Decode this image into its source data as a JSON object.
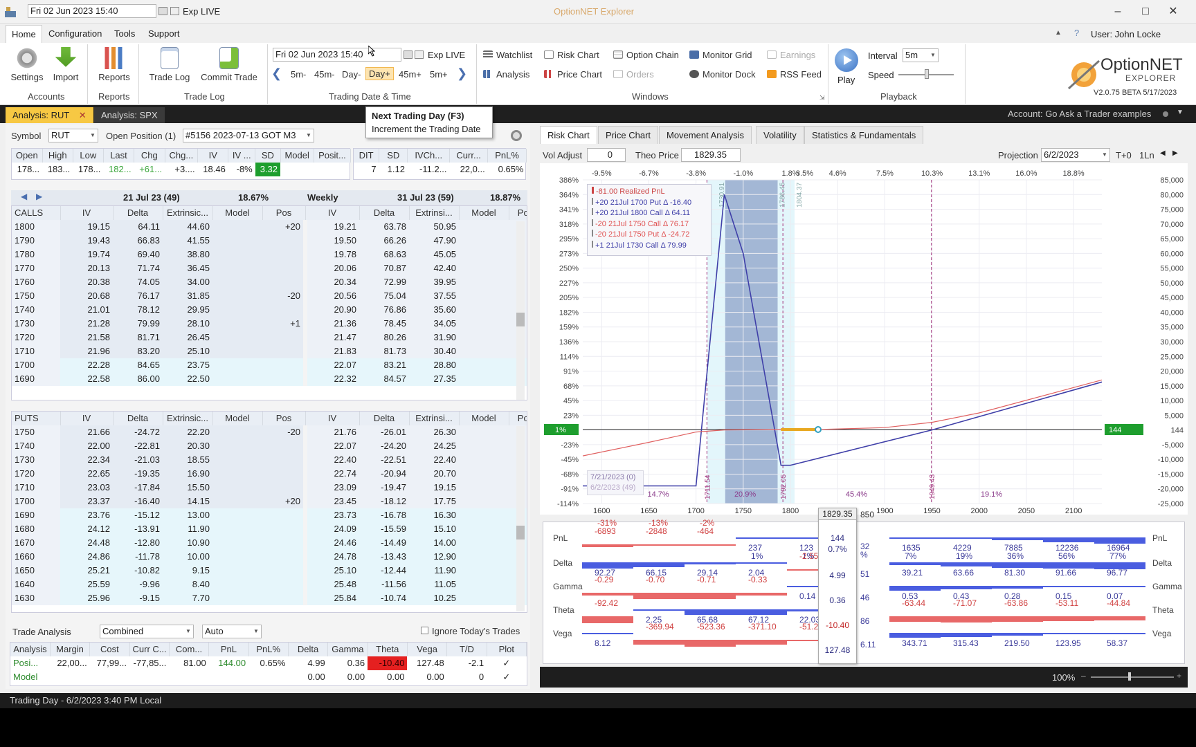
{
  "titlebar": {
    "date": "Fri 02 Jun 2023 15:40",
    "exp": "Exp LIVE",
    "app_title": "OptionNET Explorer"
  },
  "menu": {
    "tabs": [
      "Home",
      "Configuration",
      "Tools",
      "Support"
    ],
    "user": "User: John Locke"
  },
  "ribbon": {
    "settings": "Settings",
    "import": "Import",
    "reports": "Reports",
    "trade_log": "Trade Log",
    "commit_trade": "Commit Trade",
    "groups": {
      "accounts": "Accounts",
      "reports": "Reports",
      "trade_log": "Trade Log",
      "trading_date_time": "Trading Date & Time",
      "windows": "Windows",
      "playback": "Playback"
    },
    "date_field": "Fri 02 Jun 2023 15:40",
    "exp_field": "Exp LIVE",
    "nav_buttons": [
      "5m-",
      "45m-",
      "Day-",
      "Day+",
      "45m+",
      "5m+"
    ],
    "windows_items": {
      "watchlist": "Watchlist",
      "risk_chart": "Risk Chart",
      "option_chain": "Option Chain",
      "monitor_grid": "Monitor Grid",
      "earnings": "Earnings",
      "analysis": "Analysis",
      "price_chart": "Price Chart",
      "orders": "Orders",
      "monitor_dock": "Monitor Dock",
      "rss_feed": "RSS Feed"
    },
    "play": "Play",
    "interval_label": "Interval",
    "interval_value": "5m",
    "speed_label": "Speed",
    "logo_name": "OptionNET",
    "logo_sub": "EXPLORER",
    "version": "V2.0.75 BETA 5/17/2023"
  },
  "doc_tabs": {
    "tab1": "Analysis: RUT",
    "tab2": "Analysis: SPX",
    "account": "Account: Go Ask a Trader examples"
  },
  "tooltip": {
    "title": "Next Trading Day (F3)",
    "desc": "Increment the Trading Date"
  },
  "symbol_bar": {
    "symbol_label": "Symbol",
    "symbol": "RUT",
    "open_position_label": "Open Position (1)",
    "position": "#5156 2023-07-13 GOT M3"
  },
  "quote": {
    "headers": [
      "Open",
      "High",
      "Low",
      "Last",
      "Chg",
      "Chg...",
      "IV",
      "IV ...",
      "SD",
      "Model",
      "Posit..."
    ],
    "values": [
      "178...",
      "183...",
      "178...",
      "182...",
      "+61...",
      "+3....",
      "18.46",
      "-8%",
      "3.32",
      "",
      ""
    ],
    "headers2": [
      "DIT",
      "SD",
      "IVCh...",
      "Curr...",
      "PnL%"
    ],
    "values2": [
      "7",
      "1.12",
      "-11.2...",
      "22,0...",
      "0.65%"
    ]
  },
  "chain": {
    "exp1": "21 Jul 23 (49)",
    "exp1_iv": "18.67%",
    "weekly": "Weekly",
    "exp2": "31 Jul 23 (59)",
    "exp2_iv": "18.87%",
    "col_headers": [
      "IV",
      "Delta",
      "Extrinsic...",
      "Model",
      "Pos"
    ],
    "col_headers2": [
      "IV",
      "Delta",
      "Extrinsi...",
      "Model",
      "Pos"
    ],
    "calls_label": "CALLS",
    "puts_label": "PUTS",
    "calls": [
      [
        "1800",
        "19.15",
        "64.11",
        "44.60",
        "",
        "+20",
        "19.21",
        "63.78",
        "50.95",
        "",
        ""
      ],
      [
        "1790",
        "19.43",
        "66.83",
        "41.55",
        "",
        "",
        "19.50",
        "66.26",
        "47.90",
        "",
        ""
      ],
      [
        "1780",
        "19.74",
        "69.40",
        "38.80",
        "",
        "",
        "19.78",
        "68.63",
        "45.05",
        "",
        ""
      ],
      [
        "1770",
        "20.13",
        "71.74",
        "36.45",
        "",
        "",
        "20.06",
        "70.87",
        "42.40",
        "",
        ""
      ],
      [
        "1760",
        "20.38",
        "74.05",
        "34.00",
        "",
        "",
        "20.34",
        "72.99",
        "39.95",
        "",
        ""
      ],
      [
        "1750",
        "20.68",
        "76.17",
        "31.85",
        "",
        "-20",
        "20.56",
        "75.04",
        "37.55",
        "",
        ""
      ],
      [
        "1740",
        "21.01",
        "78.12",
        "29.95",
        "",
        "",
        "20.90",
        "76.86",
        "35.60",
        "",
        ""
      ],
      [
        "1730",
        "21.28",
        "79.99",
        "28.10",
        "",
        "+1",
        "21.36",
        "78.45",
        "34.05",
        "",
        ""
      ],
      [
        "1720",
        "21.58",
        "81.71",
        "26.45",
        "",
        "",
        "21.47",
        "80.26",
        "31.90",
        "",
        ""
      ],
      [
        "1710",
        "21.96",
        "83.20",
        "25.10",
        "",
        "",
        "21.83",
        "81.73",
        "30.40",
        "",
        ""
      ],
      [
        "1700",
        "22.28",
        "84.65",
        "23.75",
        "",
        "",
        "22.07",
        "83.21",
        "28.80",
        "",
        ""
      ],
      [
        "1690",
        "22.58",
        "86.00",
        "22.50",
        "",
        "",
        "22.32",
        "84.57",
        "27.35",
        "",
        ""
      ]
    ],
    "puts": [
      [
        "1750",
        "21.66",
        "-24.72",
        "22.20",
        "",
        "-20",
        "21.76",
        "-26.01",
        "26.30",
        "",
        ""
      ],
      [
        "1740",
        "22.00",
        "-22.81",
        "20.30",
        "",
        "",
        "22.07",
        "-24.20",
        "24.25",
        "",
        ""
      ],
      [
        "1730",
        "22.34",
        "-21.03",
        "18.55",
        "",
        "",
        "22.40",
        "-22.51",
        "22.40",
        "",
        ""
      ],
      [
        "1720",
        "22.65",
        "-19.35",
        "16.90",
        "",
        "",
        "22.74",
        "-20.94",
        "20.70",
        "",
        ""
      ],
      [
        "1710",
        "23.03",
        "-17.84",
        "15.50",
        "",
        "",
        "23.09",
        "-19.47",
        "19.15",
        "",
        ""
      ],
      [
        "1700",
        "23.37",
        "-16.40",
        "14.15",
        "",
        "+20",
        "23.45",
        "-18.12",
        "17.75",
        "",
        ""
      ],
      [
        "1690",
        "23.76",
        "-15.12",
        "13.00",
        "",
        "",
        "23.73",
        "-16.78",
        "16.30",
        "",
        ""
      ],
      [
        "1680",
        "24.12",
        "-13.91",
        "11.90",
        "",
        "",
        "24.09",
        "-15.59",
        "15.10",
        "",
        ""
      ],
      [
        "1670",
        "24.48",
        "-12.80",
        "10.90",
        "",
        "",
        "24.46",
        "-14.49",
        "14.00",
        "",
        ""
      ],
      [
        "1660",
        "24.86",
        "-11.78",
        "10.00",
        "",
        "",
        "24.78",
        "-13.43",
        "12.90",
        "",
        ""
      ],
      [
        "1650",
        "25.21",
        "-10.82",
        "9.15",
        "",
        "",
        "25.10",
        "-12.44",
        "11.90",
        "",
        ""
      ],
      [
        "1640",
        "25.59",
        "-9.96",
        "8.40",
        "",
        "",
        "25.48",
        "-11.56",
        "11.05",
        "",
        ""
      ],
      [
        "1630",
        "25.96",
        "-9.15",
        "7.70",
        "",
        "",
        "25.84",
        "-10.74",
        "10.25",
        "",
        ""
      ]
    ]
  },
  "trade_analysis": {
    "label": "Trade Analysis",
    "mode": "Combined",
    "auto": "Auto",
    "ignore_today": "Ignore Today's Trades",
    "headers": [
      "Analysis",
      "Margin",
      "Cost",
      "Curr C...",
      "Com...",
      "PnL",
      "PnL%",
      "Delta",
      "Gamma",
      "Theta",
      "Vega",
      "T/D",
      "Plot"
    ],
    "rows": [
      [
        "Posi...",
        "22,00...",
        "77,99...",
        "-77,85...",
        "81.00",
        "144.00",
        "0.65%",
        "4.99",
        "0.36",
        "-10.40",
        "127.48",
        "-2.1",
        "✓"
      ],
      [
        "Model",
        "",
        "",
        "",
        "",
        "",
        "",
        "0.00",
        "0.00",
        "0.00",
        "0.00",
        "0",
        "✓"
      ]
    ]
  },
  "status": "Trading Day - 6/2/2023 3:40 PM Local",
  "right_panel": {
    "tabs": [
      "Risk Chart",
      "Price Chart",
      "Movement Analysis",
      "Volatility",
      "Statistics & Fundamentals"
    ],
    "vol_adjust_label": "Vol Adjust",
    "vol_adjust": "0",
    "theo_price_label": "Theo Price",
    "theo_price": "1829.35",
    "projection_label": "Projection",
    "projection": "6/2/2023",
    "t0": "T+0",
    "oneln": "1Ln",
    "zoom": "100%"
  },
  "chart_data": {
    "type": "line",
    "title": "",
    "x_ticks": [
      1600,
      1650,
      1700,
      1750,
      1800,
      1850,
      1900,
      1950,
      2000,
      2050,
      2100
    ],
    "top_pct_ticks": [
      "-9.5%",
      "-6.7%",
      "-3.8%",
      "-1.0%",
      "1.8%",
      "3.5%",
      "4.6%",
      "7.5%",
      "10.3%",
      "13.1%",
      "16.0%",
      "18.8%"
    ],
    "left_pct_ticks": [
      "386%",
      "364%",
      "341%",
      "318%",
      "295%",
      "273%",
      "250%",
      "227%",
      "205%",
      "182%",
      "159%",
      "136%",
      "114%",
      "91%",
      "68%",
      "45%",
      "23%",
      "1%",
      "-23%",
      "-45%",
      "-68%",
      "-91%",
      "-114%"
    ],
    "right_ticks": [
      "85,000",
      "80,000",
      "75,000",
      "70,000",
      "65,000",
      "60,000",
      "55,000",
      "50,000",
      "45,000",
      "40,000",
      "35,000",
      "30,000",
      "25,000",
      "20,000",
      "15,000",
      "10,000",
      "5,000",
      "144",
      "-5,000",
      "-10,000",
      "-15,000",
      "-20,000",
      "-25,000"
    ],
    "xlim": [
      1580,
      2130
    ],
    "ylim": [
      -25000,
      85000
    ],
    "series": [
      {
        "name": "7/21/2023 (0)",
        "color": "#3f3fa8",
        "x": [
          1580,
          1700,
          1730,
          1750,
          1790,
          1800,
          1950,
          2130
        ],
        "y": [
          -19000,
          -19000,
          80000,
          60000,
          -12000,
          -12000,
          0,
          16300
        ]
      },
      {
        "name": "6/2/2023 (49)",
        "color": "#e06060",
        "x": [
          1580,
          1650,
          1700,
          1730,
          1790,
          1829,
          1900,
          1950,
          2000,
          2130
        ],
        "y": [
          -8800,
          -4200,
          -700,
          0,
          150,
          144,
          800,
          2600,
          5800,
          17000
        ]
      }
    ],
    "vlines": [
      {
        "x": 1711.54,
        "label": "1711.54"
      },
      {
        "x": 1792.05,
        "label": "1792.05"
      },
      {
        "x": 1949.43,
        "label": "1949.43"
      }
    ],
    "shaded_bands": [
      {
        "from": 1730.91,
        "to": 1786.45,
        "label_low": "1730.91",
        "label_high": "1786.45"
      },
      {
        "from": 1712,
        "to": 1804.37,
        "label_high": "1804.37"
      }
    ],
    "band_pcts": [
      "14.7%",
      "20.9%",
      "45.4%",
      "19.1%"
    ],
    "current_price": "1829.35",
    "legend_title": "-81.00 Realized PnL",
    "legend": [
      {
        "label": "+20 21Jul 1700 Put Δ",
        "value": "-16.40",
        "color": "#3f3fa8"
      },
      {
        "label": "+20 21Jul 1800 Call Δ",
        "value": "64.11",
        "color": "#3f3fa8"
      },
      {
        "label": "-20 21Jul 1750 Call Δ",
        "value": "76.17",
        "color": "#e05050"
      },
      {
        "label": "-20 21Jul 1750 Put Δ",
        "value": "-24.72",
        "color": "#e05050"
      },
      {
        "label": "+1 21Jul 1730 Call Δ",
        "value": "79.99",
        "color": "#3f3fa8"
      }
    ],
    "date_labels": [
      "7/21/2023 (0)",
      "6/2/2023 (49)"
    ],
    "current_pct": "1%",
    "current_pnl": "144"
  },
  "greeks_strip": {
    "rows": [
      "PnL",
      "Delta",
      "Gamma",
      "Theta",
      "Vega"
    ],
    "pnl_pct": [
      "-31%",
      "-13%",
      "-2%",
      "1%",
      "1%",
      "",
      "7%",
      "19%",
      "36%",
      "56%",
      "77%"
    ],
    "pnl": [
      "-6893",
      "-2848",
      "-464",
      "237",
      "123",
      "",
      "1635",
      "4229",
      "7885",
      "12236",
      "16964"
    ],
    "delta": [
      "92.27",
      "66.15",
      "29.14",
      "2.04",
      "-2.55",
      "",
      "39.21",
      "63.66",
      "81.30",
      "91.66",
      "96.77"
    ],
    "gamma": [
      "-0.29",
      "-0.70",
      "-0.71",
      "-0.33",
      "0.14",
      "",
      "0.53",
      "0.43",
      "0.28",
      "0.15",
      "0.07"
    ],
    "theta": [
      "-92.42",
      "2.25",
      "65.68",
      "67.12",
      "22.03",
      "",
      "-63.44",
      "-71.07",
      "-63.86",
      "-53.11",
      "-44.84"
    ],
    "vega": [
      "8.12",
      "-369.94",
      "-523.36",
      "-371.10",
      "-51.25",
      "",
      "343.71",
      "315.43",
      "219.50",
      "123.95",
      "58.37"
    ],
    "hover": {
      "price": "1829.35",
      "pnl": "144",
      "pnl_pct": "0.7%",
      "delta": "4.99",
      "gamma": "0.36",
      "theta": "-10.40",
      "vega": "127.48"
    },
    "partials": {
      "pnl": "32",
      "pnl_pct": "%",
      "delta": "51",
      "gamma": "46",
      "theta": "86",
      "vega": "6.11",
      "price": "850"
    }
  }
}
